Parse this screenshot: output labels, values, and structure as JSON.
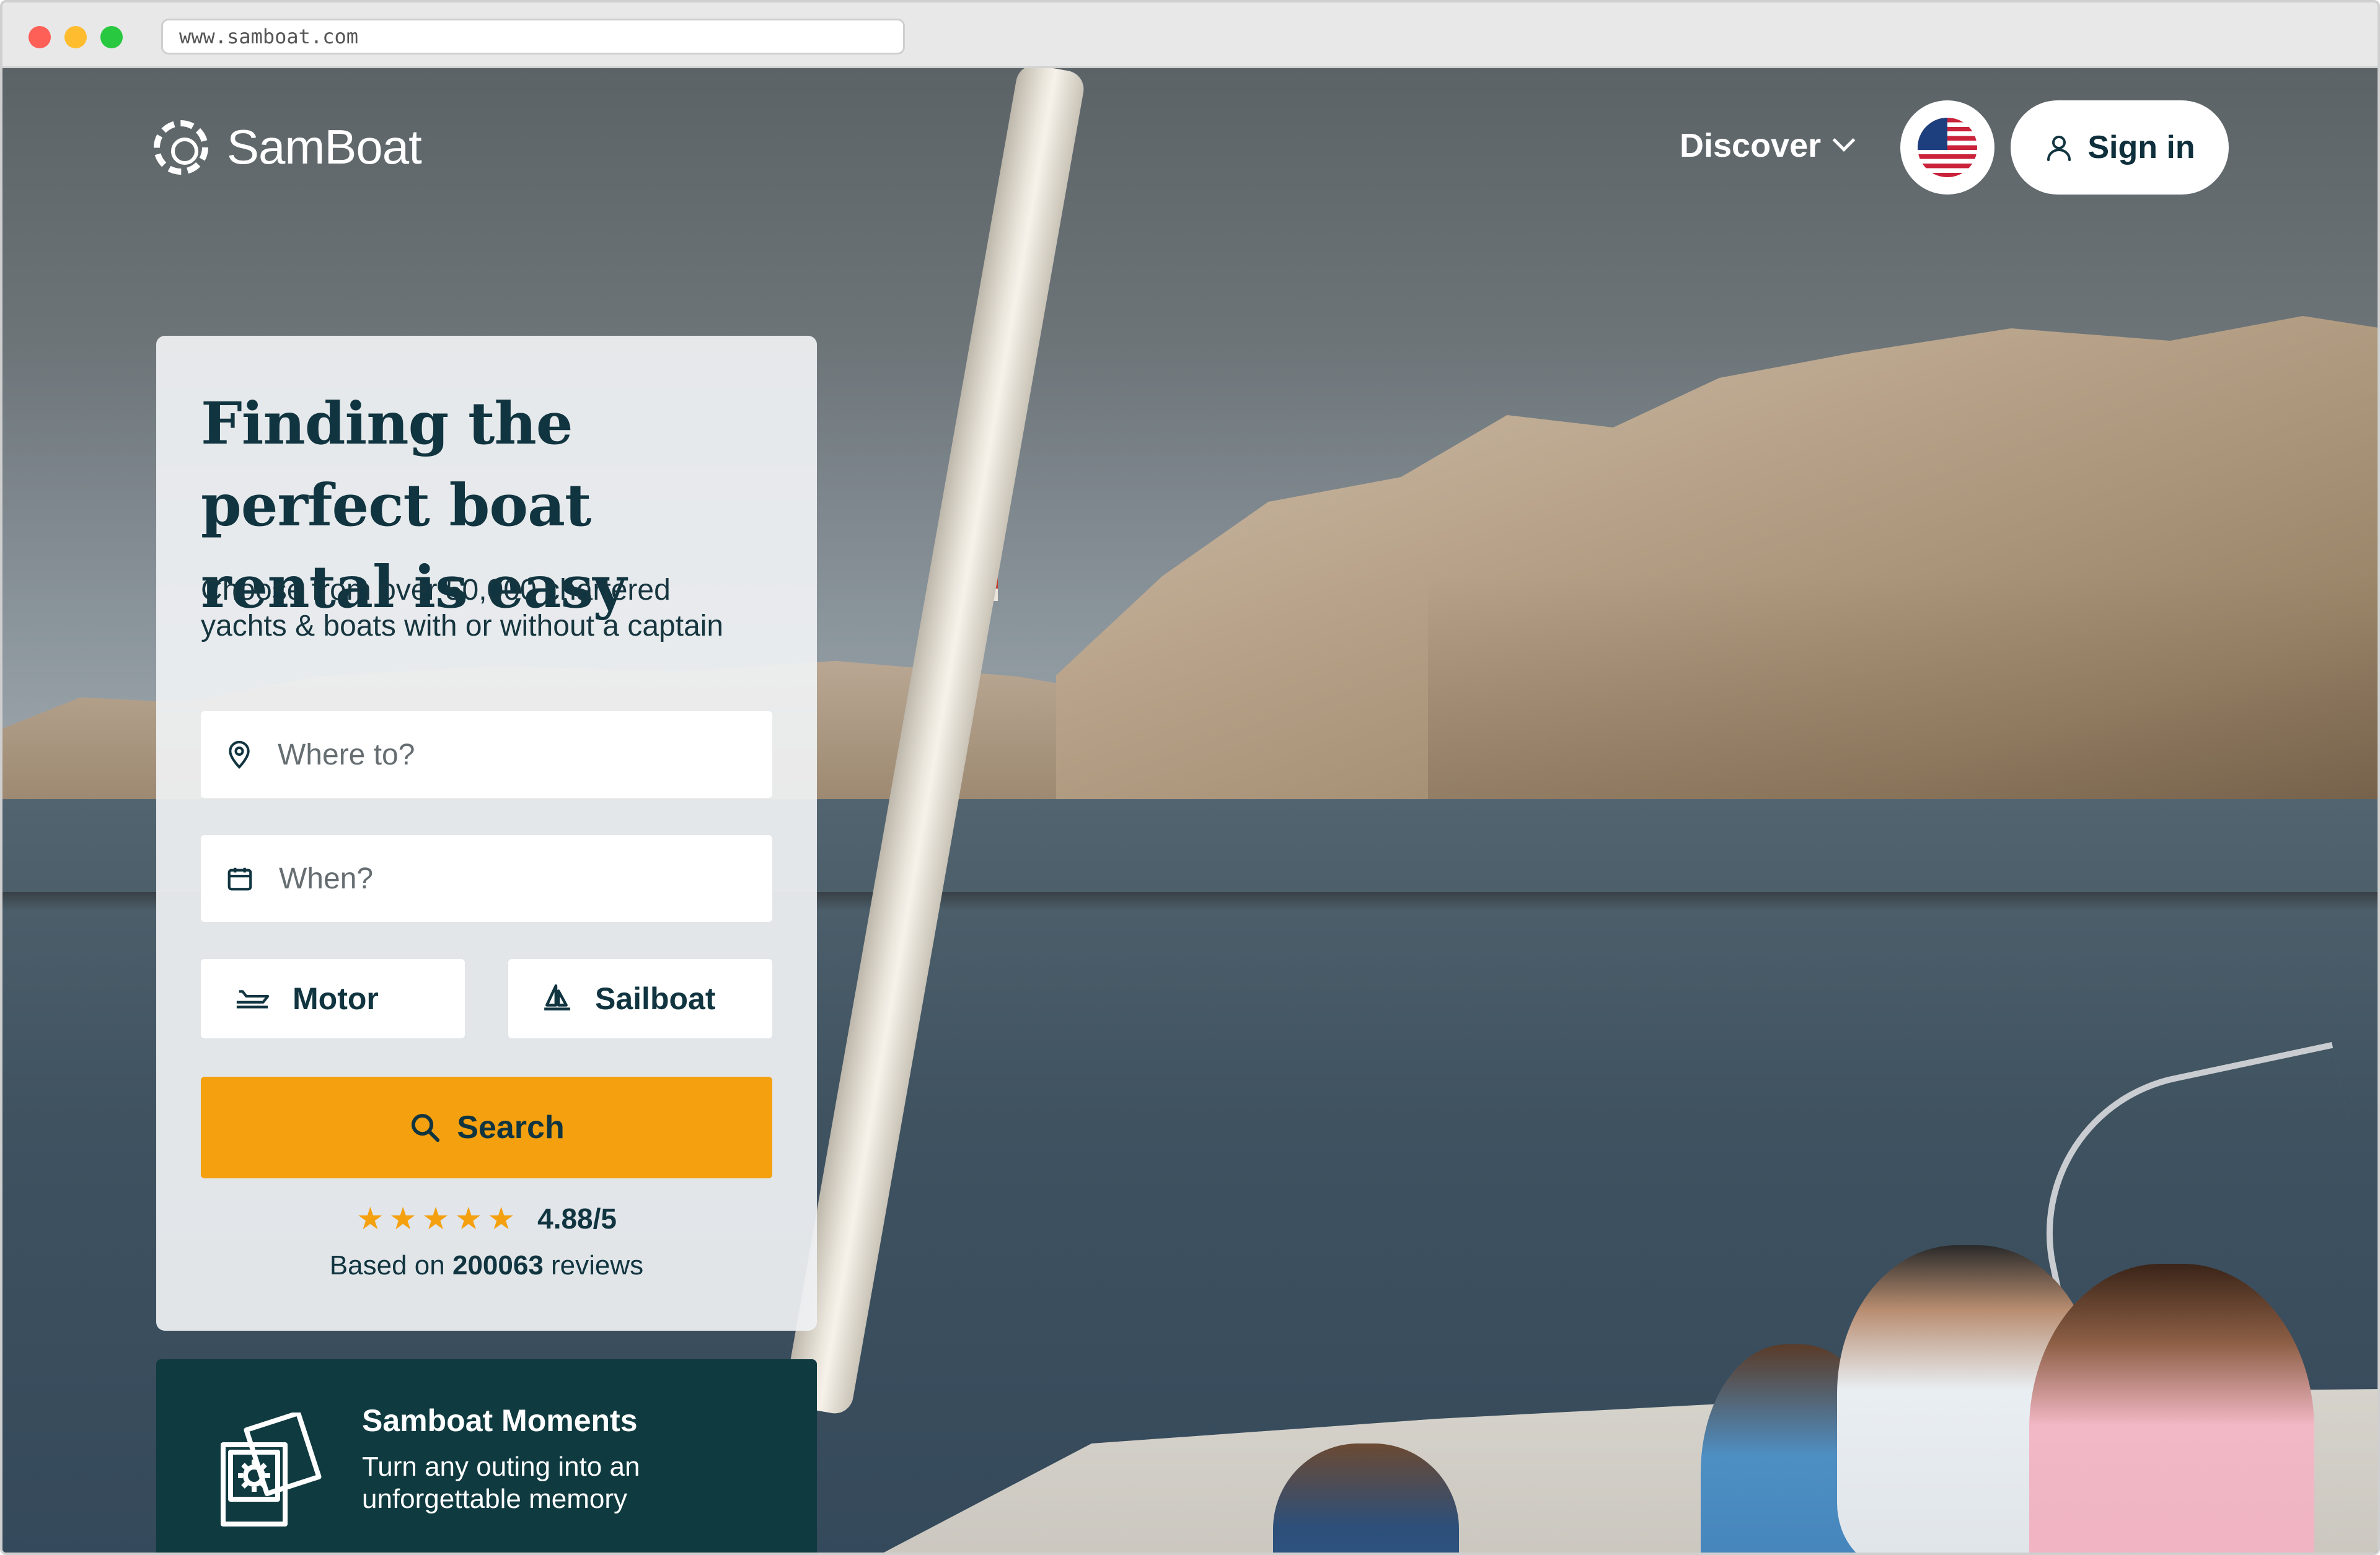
{
  "browser": {
    "url": "www.samboat.com"
  },
  "header": {
    "logo_text": "SamBoat",
    "discover_label": "Discover",
    "language_flag": "us-flag-icon",
    "signin_label": "Sign in"
  },
  "search_card": {
    "headline": "Finding the perfect boat rental is easy",
    "subtitle": "Choose from over 50,000 chartered yachts & boats with or without a captain",
    "where_placeholder": "Where to?",
    "when_placeholder": "When?",
    "motor_label": "Motor",
    "sailboat_label": "Sailboat",
    "search_label": "Search",
    "rating_value": "4.88/5",
    "rating_stars": 5,
    "reviews_prefix": "Based on",
    "reviews_count": "200063",
    "reviews_suffix": "reviews"
  },
  "moments": {
    "title": "Samboat Moments",
    "text": "Turn any outing into an unforgettable memory"
  },
  "colors": {
    "accent": "#f4a00f",
    "primary_dark": "#113540",
    "moments_bg": "#0f3a40"
  }
}
